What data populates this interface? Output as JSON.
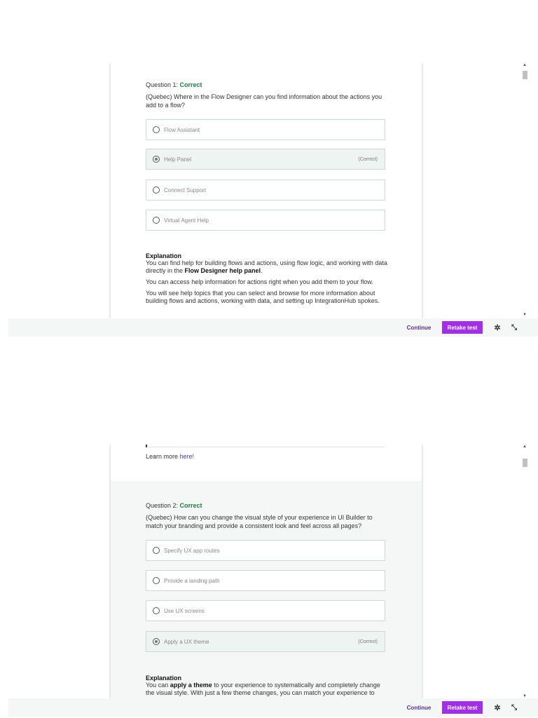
{
  "frame1": {
    "question_label": "Question 1:",
    "status": "Correct",
    "question_text": "(Quebec) Where in the Flow Designer can you find information about the actions you add to a flow?",
    "options": [
      {
        "label": "Flow Assistant",
        "correct_tag": "",
        "checked": false
      },
      {
        "label": "Help Panel",
        "correct_tag": "(Correct)",
        "checked": true
      },
      {
        "label": "Connect Support",
        "correct_tag": "",
        "checked": false
      },
      {
        "label": "Virtual Agent Help",
        "correct_tag": "",
        "checked": false
      }
    ],
    "explanation_title": "Explanation",
    "explanation_p1_pre": "You can find help for building flows and actions, using flow logic, and working with data directly in the ",
    "explanation_p1_bold": "Flow Designer help panel",
    "explanation_p1_post": ".",
    "explanation_p2": "You can access help information for actions right when you add them to your flow.",
    "explanation_p3": "You will see help topics that you can select and browse for more information about building flows and actions, working with data, and setting up IntegrationHub spokes."
  },
  "frame2": {
    "learn_more_text": "Learn more ",
    "learn_more_link": "here!",
    "question_label": "Question 2:",
    "status": "Correct",
    "question_text": "(Quebec) How can you change the visual style of your experience in UI Builder to match your branding and provide a consistent look and feel across all pages?",
    "options": [
      {
        "label": "Specify UX app routes",
        "correct_tag": "",
        "checked": false
      },
      {
        "label": "Provide a landing path",
        "correct_tag": "",
        "checked": false
      },
      {
        "label": "Use UX screens",
        "correct_tag": "",
        "checked": false
      },
      {
        "label": "Apply a UX theme",
        "correct_tag": "(Correct)",
        "checked": true
      }
    ],
    "explanation_title": "Explanation",
    "explanation_p1_pre": "You can ",
    "explanation_p1_bold": "apply a theme",
    "explanation_p1_post": " to your experience to systematically and completely change the visual style. With just a few theme changes, you can match your experience to"
  },
  "footer": {
    "continue_label": "Continue",
    "retake_label": "Retake test",
    "settings_icon": "gear-icon",
    "collapse_icon": "collapse-icon"
  },
  "colors": {
    "correct_green": "#1b7a43",
    "retake_purple": "#a12fe8",
    "continue_purple": "#5b2d90",
    "link_blue": "#4a3ad6"
  }
}
